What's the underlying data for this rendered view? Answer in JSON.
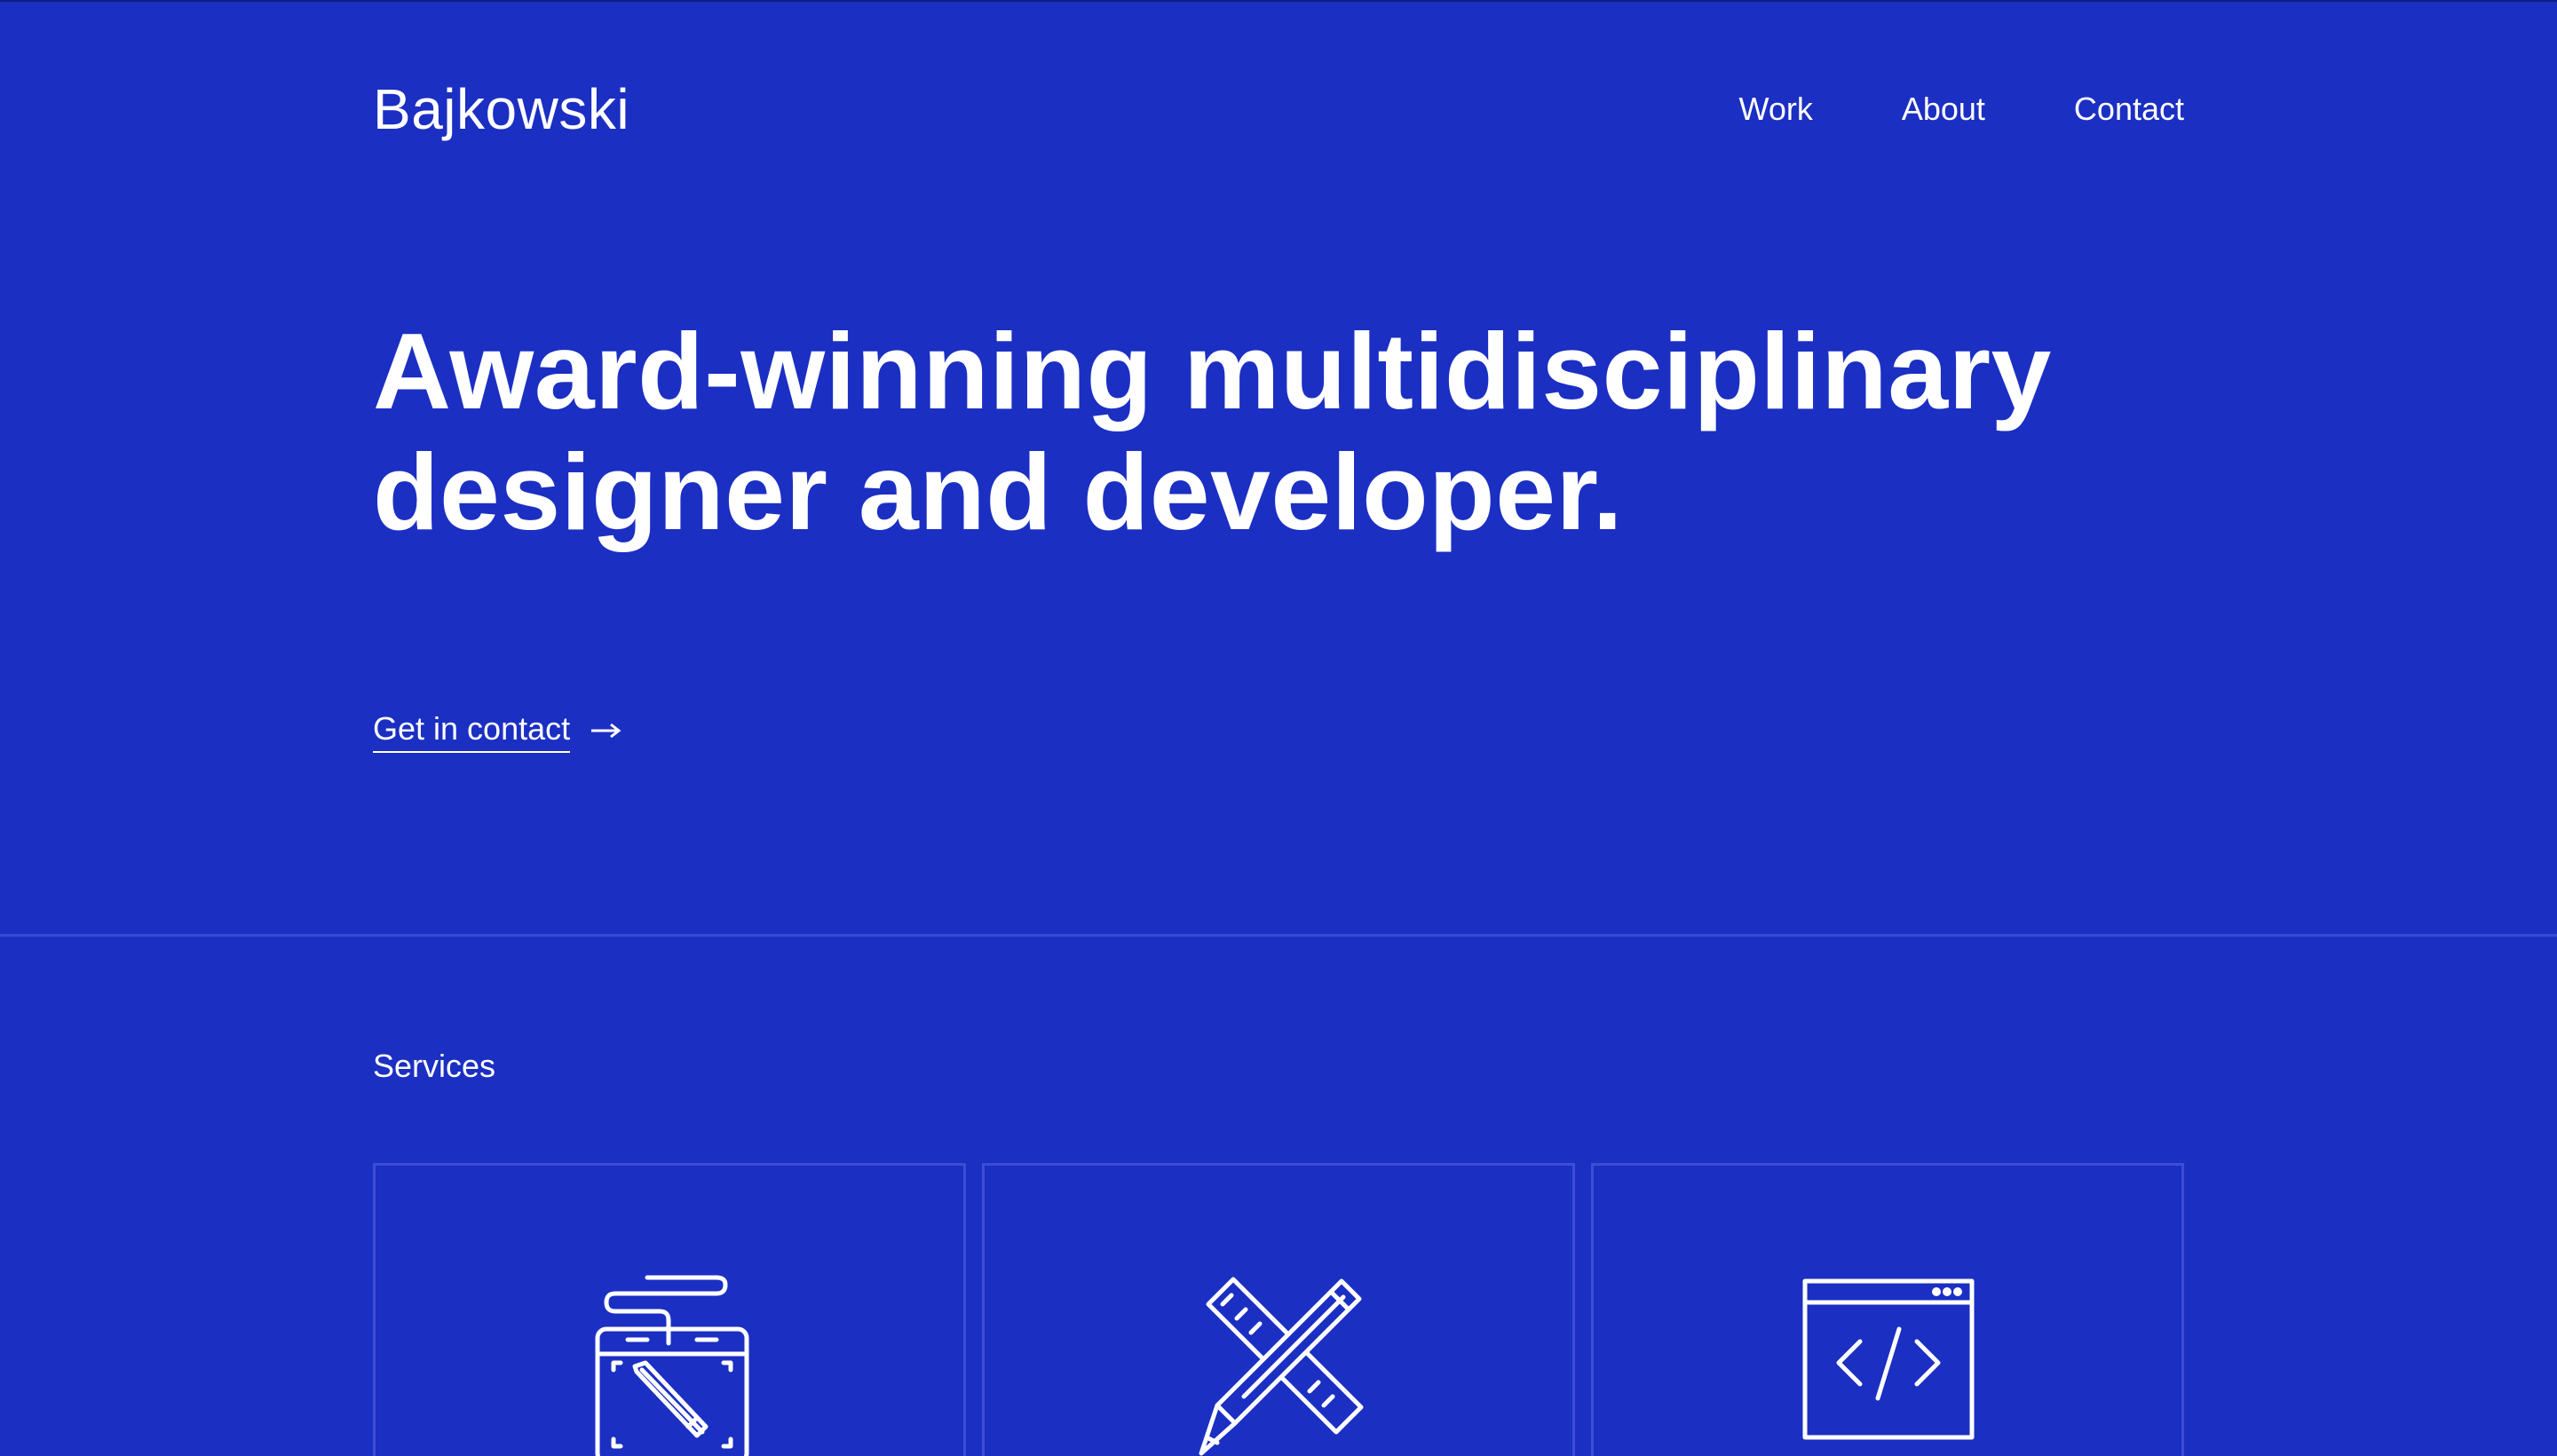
{
  "brand": {
    "name": "Bajkowski"
  },
  "nav": {
    "items": [
      "Work",
      "About",
      "Contact"
    ]
  },
  "hero": {
    "title_line1": "Award-winning multidisciplinary",
    "title_line2": "designer and developer."
  },
  "cta": {
    "label": "Get in contact",
    "arrow_icon": "arrow-right-icon"
  },
  "services": {
    "heading": "Services",
    "cards": [
      {
        "icon": "drawing-tablet-icon"
      },
      {
        "icon": "pencil-ruler-icon"
      },
      {
        "icon": "browser-code-icon"
      }
    ]
  },
  "colors": {
    "background": "#1b2fc3",
    "text": "#ffffff",
    "card_border": "#3c4dd6",
    "divider": "#3a4bd0"
  }
}
